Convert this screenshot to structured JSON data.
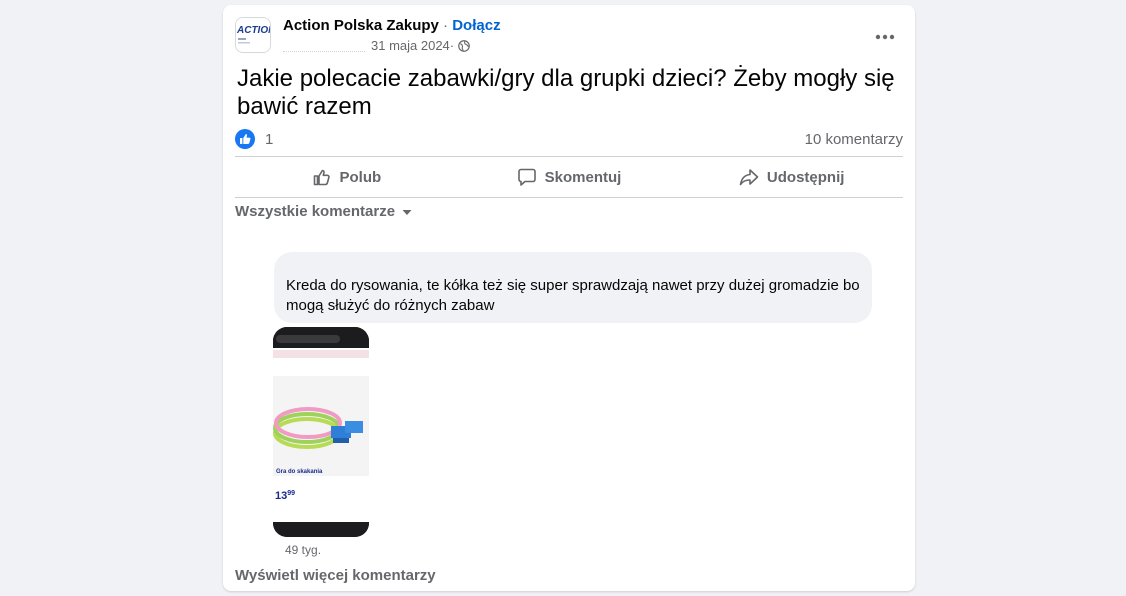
{
  "post": {
    "group_name": "Action Polska Zakupy",
    "separator": " · ",
    "join_label": "Dołącz",
    "date": "31 maja 2024",
    "date_separator": " · ",
    "logo_text": "ACTION",
    "text": "Jakie polecacie zabawki/gry dla grupki dzieci? Żeby mogły się bawić razem",
    "reaction_count": "1",
    "comment_count": "10 komentarzy"
  },
  "actions": {
    "like": "Polub",
    "comment": "Skomentuj",
    "share": "Udostępnij"
  },
  "comments": {
    "filter_label": "Wszystkie komentarze",
    "items": [
      {
        "text": "Kreda do rysowania, te kółka też się super sprawdzają nawet przy dużej gromadzie bo mogą służyć do różnych zabaw",
        "time": "49 tyg.",
        "image": {
          "product_title": "Gra do skakania",
          "price_main": "13",
          "price_cents": "99"
        }
      }
    ],
    "view_more_label": "Wyświetl więcej komentarzy"
  },
  "colors": {
    "accent": "#0064d1",
    "like_blue": "#1877f2",
    "secondary_text": "#65676b",
    "bubble_bg": "#f0f2f5"
  },
  "icons": [
    "action-logo-icon",
    "more-options-icon",
    "globe-icon",
    "like-reaction-icon",
    "thumbs-up-icon",
    "comment-icon",
    "share-icon",
    "chevron-down-icon"
  ]
}
